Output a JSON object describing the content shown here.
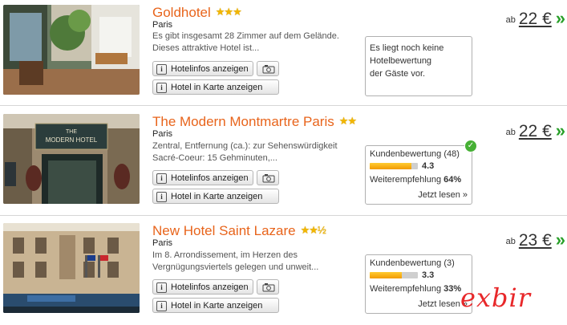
{
  "hotels": [
    {
      "name": "Goldhotel",
      "stars": "★★★",
      "city": "Paris",
      "desc1": "Es gibt insgesamt 28 Zimmer auf dem Gelände.",
      "desc2": "Dieses attraktive Hotel ist...",
      "info_button": "Hotelinfos anzeigen",
      "map_button": "Hotel in Karte anzeigen",
      "price_prefix": "ab",
      "price": "22 €",
      "review": {
        "empty1": "Es liegt noch keine",
        "empty2": "Hotelbewertung",
        "empty3": "der Gäste vor."
      }
    },
    {
      "name": "The Modern Montmartre Paris",
      "stars": "★★",
      "city": "Paris",
      "desc1": "Zentral, Entfernung (ca.): zur Sehenswürdigkeit",
      "desc2": "Sacré-Coeur: 15 Gehminuten,...",
      "info_button": "Hotelinfos anzeigen",
      "map_button": "Hotel in Karte anzeigen",
      "price_prefix": "ab",
      "price": "22 €",
      "review": {
        "title": "Kundenbewertung (48)",
        "score": "4.3",
        "score_fraction": 0.86,
        "rec_label": "Weiterempfehlung",
        "rec_value": "64%",
        "more": "Jetzt lesen »"
      },
      "sign_line1": "THE",
      "sign_line2": "MODERN HOTEL"
    },
    {
      "name": "New Hotel Saint Lazare",
      "stars": "★★½",
      "city": "Paris",
      "desc1": "Im 8. Arrondissement, im Herzen des",
      "desc2": "Vergnügungsviertels gelegen und unweit...",
      "info_button": "Hotelinfos anzeigen",
      "map_button": "Hotel in Karte anzeigen",
      "price_prefix": "ab",
      "price": "23 €",
      "review": {
        "title": "Kundenbewertung (3)",
        "score": "3.3",
        "score_fraction": 0.66,
        "rec_label": "Weiterempfehlung",
        "rec_value": "33%",
        "more": "Jetzt lesen »"
      }
    }
  ],
  "watermark": "exbir",
  "colors": {
    "accent": "#e8641b",
    "arrow": "#2aa02a",
    "star": "#f2b600",
    "watermark": "#e8282a"
  }
}
